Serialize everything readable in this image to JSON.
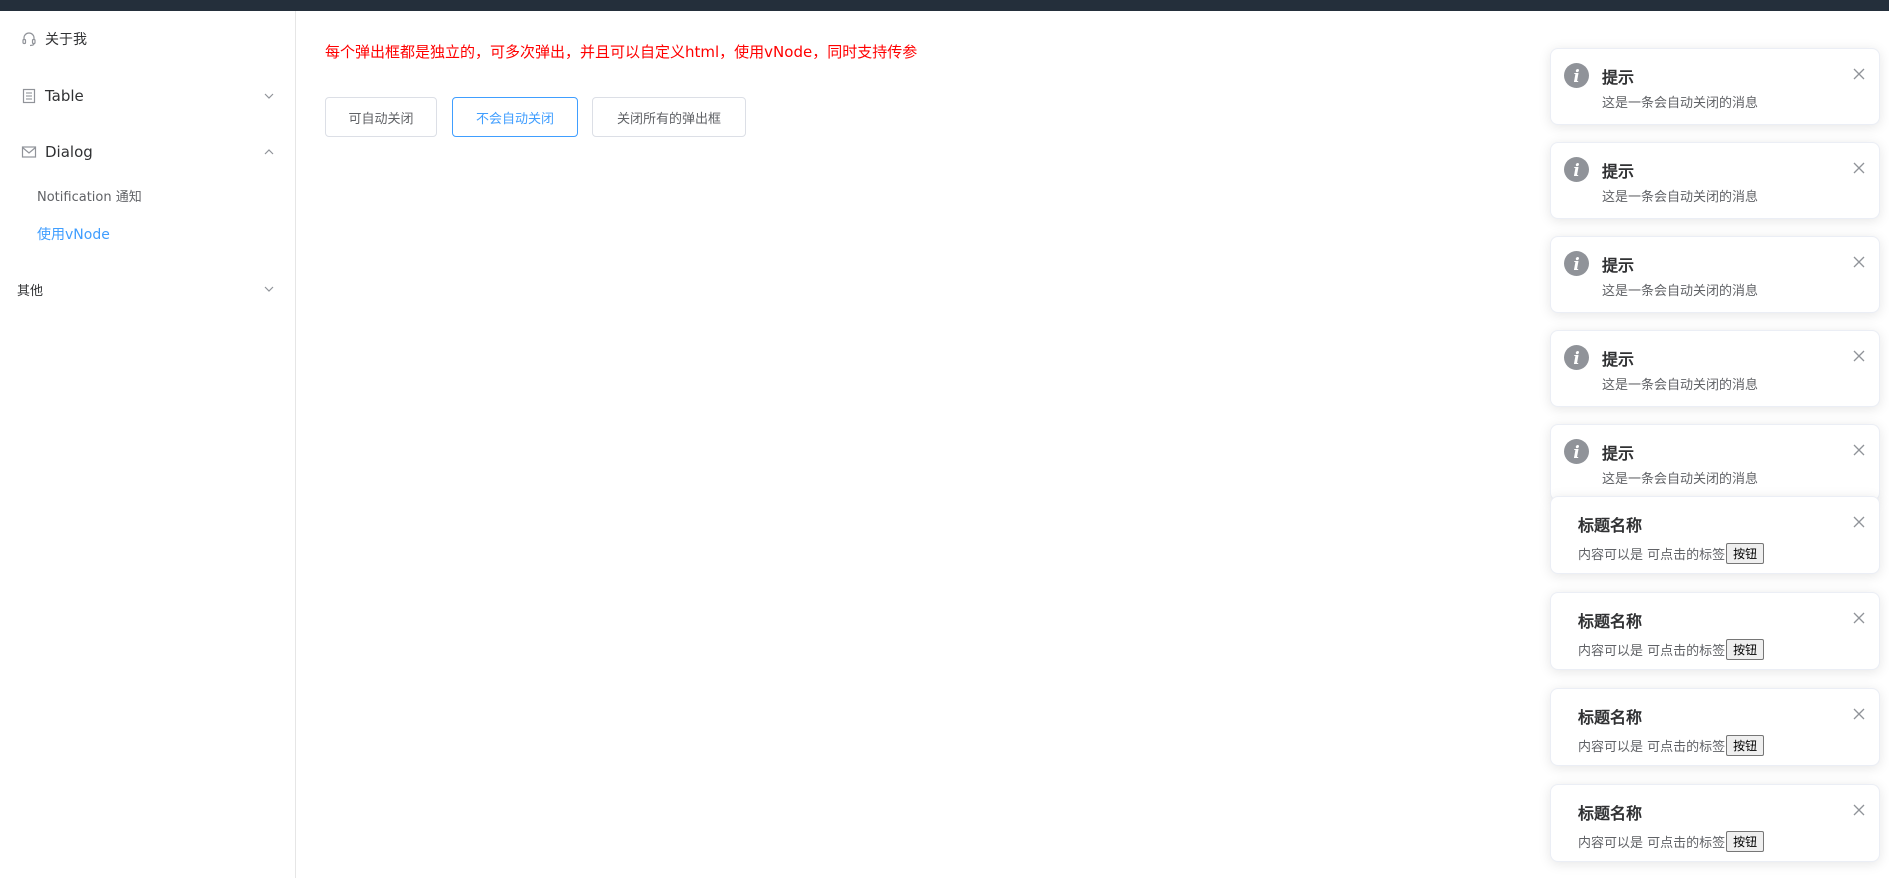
{
  "colors": {
    "accent": "#409eff",
    "tip_text": "#ff0000",
    "topbar": "#242f3b",
    "info_icon": "#909399"
  },
  "sidebar": {
    "items": [
      {
        "label": "关于我",
        "icon": "headset-icon"
      },
      {
        "label": "Table",
        "icon": "document-icon",
        "arrow": "chevron-down-icon"
      },
      {
        "label": "Dialog",
        "icon": "envelope-icon",
        "arrow": "chevron-up-icon",
        "children": [
          {
            "label": "Notification 通知"
          },
          {
            "label": "使用vNode",
            "active": true
          }
        ]
      },
      {
        "label": "其他",
        "arrow": "chevron-down-icon"
      }
    ]
  },
  "main": {
    "tip": "每个弹出框都是独立的，可多次弹出，并且可以自定义html，使用vNode，同时支持传参",
    "buttons": {
      "auto_close": "可自动关闭",
      "no_auto_close": "不会自动关闭",
      "close_all": "关闭所有的弹出框"
    }
  },
  "notifications": {
    "info": [
      {
        "title": "提示",
        "message": "这是一条会自动关闭的消息"
      },
      {
        "title": "提示",
        "message": "这是一条会自动关闭的消息"
      },
      {
        "title": "提示",
        "message": "这是一条会自动关闭的消息"
      },
      {
        "title": "提示",
        "message": "这是一条会自动关闭的消息"
      },
      {
        "title": "提示",
        "message": "这是一条会自动关闭的消息"
      }
    ],
    "custom": [
      {
        "title": "标题名称",
        "message": "内容可以是 可点击的标签",
        "button": "按钮"
      },
      {
        "title": "标题名称",
        "message": "内容可以是 可点击的标签",
        "button": "按钮"
      },
      {
        "title": "标题名称",
        "message": "内容可以是 可点击的标签",
        "button": "按钮"
      },
      {
        "title": "标题名称",
        "message": "内容可以是 可点击的标签",
        "button": "按钮"
      }
    ]
  }
}
